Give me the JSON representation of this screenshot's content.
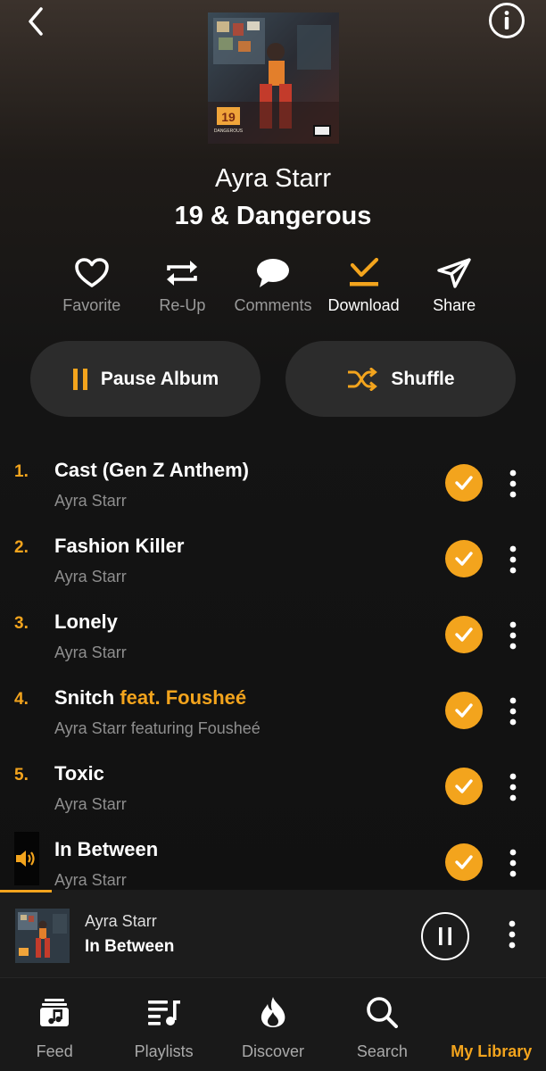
{
  "header": {
    "back_icon": "chevron-left-icon",
    "info_icon": "info-icon"
  },
  "album": {
    "artist": "Ayra Starr",
    "title": "19 & Dangerous",
    "cover_badge": "19",
    "cover_badge_sub": "DANGEROUS"
  },
  "actions": [
    {
      "label": "Favorite",
      "icon": "heart-icon"
    },
    {
      "label": "Re-Up",
      "icon": "repost-icon"
    },
    {
      "label": "Comments",
      "icon": "comment-icon"
    },
    {
      "label": "Download",
      "icon": "download-check-icon"
    },
    {
      "label": "Share",
      "icon": "send-icon"
    }
  ],
  "buttons": {
    "pause_album": "Pause Album",
    "shuffle": "Shuffle"
  },
  "tracks": [
    {
      "num": "1.",
      "title": "Cast (Gen Z Anthem)",
      "feat": "",
      "artist": "Ayra Starr",
      "downloaded": true,
      "playing": false
    },
    {
      "num": "2.",
      "title": "Fashion Killer",
      "feat": "",
      "artist": "Ayra Starr",
      "downloaded": true,
      "playing": false
    },
    {
      "num": "3.",
      "title": "Lonely",
      "feat": "",
      "artist": "Ayra Starr",
      "downloaded": true,
      "playing": false
    },
    {
      "num": "4.",
      "title": "Snitch ",
      "feat": "feat. Fousheé",
      "artist": "Ayra Starr featuring Fousheé",
      "downloaded": true,
      "playing": false
    },
    {
      "num": "5.",
      "title": "Toxic",
      "feat": "",
      "artist": "Ayra Starr",
      "downloaded": true,
      "playing": false
    },
    {
      "num": "",
      "title": "In Between",
      "feat": "",
      "artist": "Ayra Starr",
      "downloaded": true,
      "playing": true
    }
  ],
  "now_playing": {
    "artist": "Ayra Starr",
    "title": "In Between",
    "progress": 0.09
  },
  "tabs": [
    {
      "label": "Feed",
      "icon": "feed-icon",
      "active": false
    },
    {
      "label": "Playlists",
      "icon": "playlist-icon",
      "active": false
    },
    {
      "label": "Discover",
      "icon": "flame-icon",
      "active": false
    },
    {
      "label": "Search",
      "icon": "search-icon",
      "active": false
    },
    {
      "label": "My Library",
      "icon": "library-icon",
      "active": true
    }
  ],
  "colors": {
    "accent": "#f3a41d",
    "background": "#141414",
    "pill": "#2c2c2c",
    "muted_text": "#8e8e8e"
  }
}
